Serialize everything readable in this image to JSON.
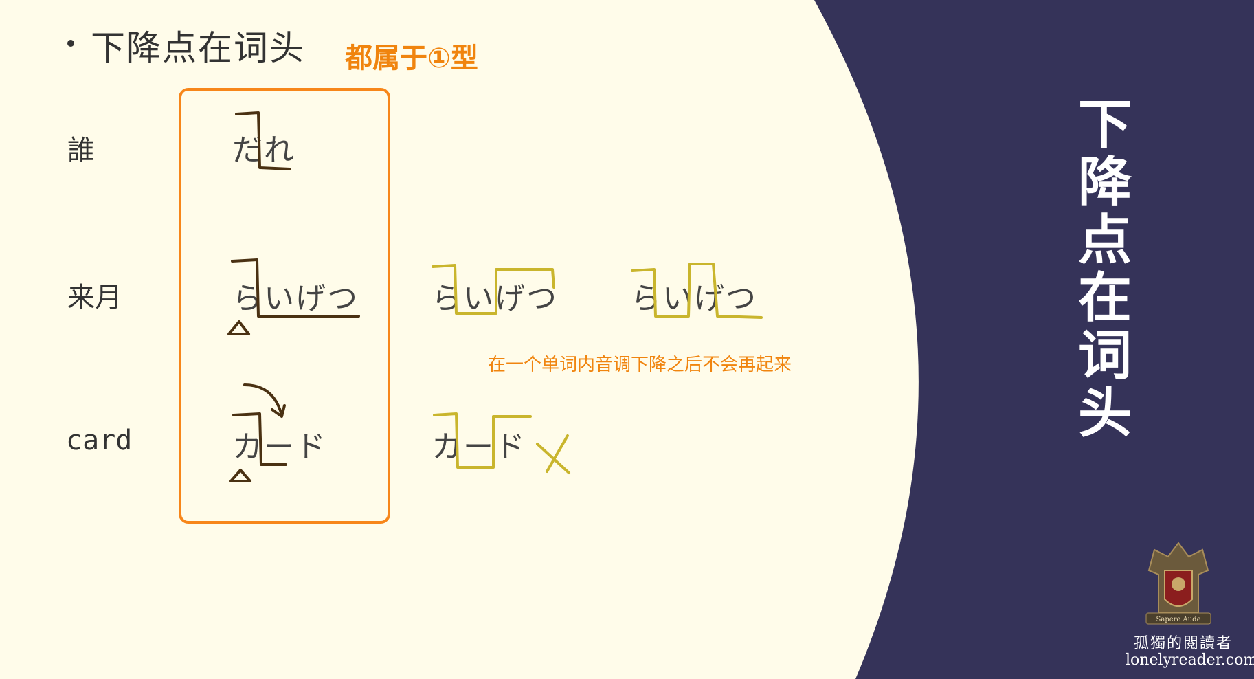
{
  "bullet": {
    "text": "下降点在词头"
  },
  "note": {
    "text": "都属于①型"
  },
  "rows": [
    {
      "label": "誰",
      "kana": "だれ"
    },
    {
      "label": "来月",
      "kana": "らいげつ"
    },
    {
      "label": "card",
      "kana": "カード"
    }
  ],
  "variants": {
    "raigetsu_a": "らいげつ",
    "raigetsu_b": "らいげつ",
    "kado_wrong": "カード"
  },
  "explanation": "在一个单词内音调下降之后不会再起来",
  "side_title": [
    "下",
    "降",
    "点",
    "在",
    "词",
    "头"
  ],
  "brand": {
    "cn": "孤獨的閱讀者",
    "url": "lonelyreader.com",
    "logo_motto": "Sapere Aude"
  },
  "colors": {
    "background": "#fffcea",
    "side_panel": "#353359",
    "accent_orange": "#f7861a",
    "pitch_brown": "#4a3112",
    "pitch_olive": "#c9b52d"
  }
}
